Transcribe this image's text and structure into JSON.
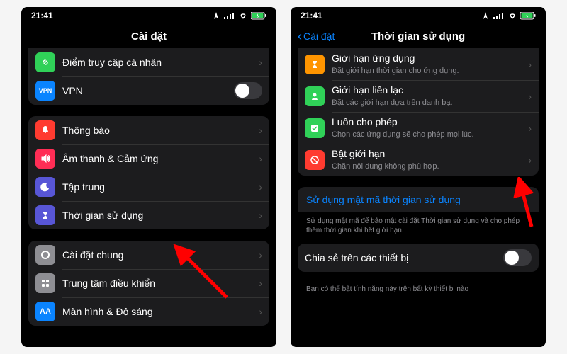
{
  "status": {
    "time": "21:41"
  },
  "phone1": {
    "title": "Cài đặt",
    "groups": [
      [
        {
          "icon": "link",
          "bg": "#30d158",
          "title": "Điểm truy cập cá nhân",
          "type": "chev"
        },
        {
          "icon": "vpn",
          "bg": "#0a84ff",
          "title": "VPN",
          "type": "toggle"
        }
      ],
      [
        {
          "icon": "bell",
          "bg": "#ff3b30",
          "title": "Thông báo",
          "type": "chev"
        },
        {
          "icon": "sound",
          "bg": "#ff2d55",
          "title": "Âm thanh & Cảm ứng",
          "type": "chev"
        },
        {
          "icon": "moon",
          "bg": "#5856d6",
          "title": "Tập trung",
          "type": "chev"
        },
        {
          "icon": "hourglass",
          "bg": "#5856d6",
          "title": "Thời gian sử dụng",
          "type": "chev"
        }
      ],
      [
        {
          "icon": "gear",
          "bg": "#8e8e93",
          "title": "Cài đặt chung",
          "type": "chev"
        },
        {
          "icon": "control",
          "bg": "#8e8e93",
          "title": "Trung tâm điều khiển",
          "type": "chev"
        },
        {
          "icon": "aa",
          "bg": "#0a84ff",
          "title": "Màn hình & Độ sáng",
          "type": "chev"
        }
      ]
    ]
  },
  "phone2": {
    "back": "Cài đặt",
    "title": "Thời gian sử dụng",
    "rows": [
      {
        "icon": "hourglass",
        "bg": "#ff9500",
        "title": "Giới hạn ứng dụng",
        "subtitle": "Đặt giới hạn thời gian cho ứng dụng."
      },
      {
        "icon": "person",
        "bg": "#30d158",
        "title": "Giới hạn liên lạc",
        "subtitle": "Đặt các giới hạn dựa trên danh bạ."
      },
      {
        "icon": "check",
        "bg": "#30d158",
        "title": "Luôn cho phép",
        "subtitle": "Chọn các ứng dụng sẽ cho phép mọi lúc."
      },
      {
        "icon": "block",
        "bg": "#ff3b30",
        "title": "Bật giới hạn",
        "subtitle": "Chặn nội dung không phù hợp."
      }
    ],
    "passcode_link": "Sử dụng mật mã thời gian sử dụng",
    "passcode_note": "Sử dụng mật mã để bảo mật cài đặt Thời gian sử dụng và cho phép thêm thời gian khi hết giới hạn.",
    "share_title": "Chia sẻ trên các thiết bị",
    "share_note": "Bạn có thể bật tính năng này trên bất kỳ thiết bị nào"
  }
}
